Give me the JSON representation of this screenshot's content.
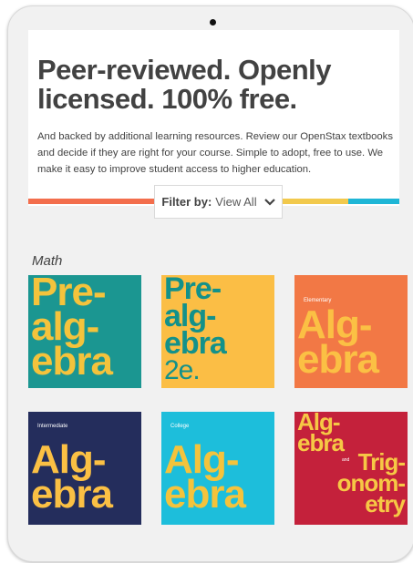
{
  "hero": {
    "headline": "Peer-reviewed. Openly licensed. 100% free.",
    "description": "And backed by additional learning resources. Review our OpenStax textbooks and decide if they are right for your course. Simple to adopt, free to use. We make it easy to improve student access to higher education."
  },
  "filter": {
    "label": "Filter by:",
    "value": "View All",
    "icon": "chevron-down-icon"
  },
  "stripe_colors": [
    "#f36e4c",
    "#ffffff",
    "#f2c94c",
    "#1fb6d6"
  ],
  "section_title": "Math",
  "books": [
    {
      "lines": [
        "Pre-",
        "alg-",
        "ebra"
      ],
      "subtitle": "",
      "bg": "#1b9691",
      "fg": "#f4c33c"
    },
    {
      "lines": [
        "Pre-",
        "alg-",
        "ebra"
      ],
      "edition": "2e.",
      "bg": "#fbbe45",
      "fg": "#13918a"
    },
    {
      "lines": [
        "Alg-",
        "ebra"
      ],
      "subtitle": "Elementary",
      "bg": "#f27845",
      "fg": "#fbc044"
    },
    {
      "lines": [
        "Alg-",
        "ebra"
      ],
      "subtitle": "Intermediate",
      "bg": "#242d5c",
      "fg": "#fbc044"
    },
    {
      "lines": [
        "Alg-",
        "ebra"
      ],
      "subtitle": "College",
      "bg": "#1dbedb",
      "fg": "#f4c33c"
    },
    {
      "lines": [
        "Alg-",
        "ebra"
      ],
      "connector": "and",
      "lines2": [
        "Trig-",
        "onom-",
        "etry"
      ],
      "bg": "#c4213b",
      "fg": "#f6c845"
    }
  ]
}
